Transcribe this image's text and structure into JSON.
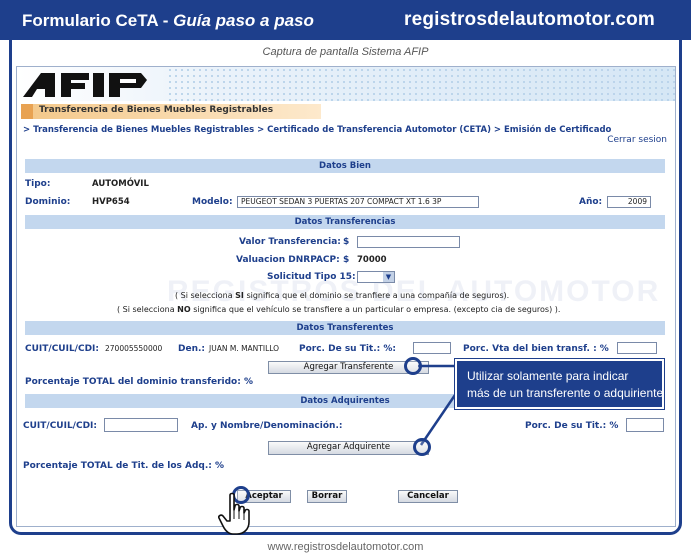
{
  "guide": {
    "title_plain": "Formulario CeTA - ",
    "title_italic": "Guía paso a paso",
    "site": "registrosdelautomotor.com",
    "caption": "Captura de pantalla Sistema AFIP",
    "footer": "www.registrosdelautomotor.com"
  },
  "afip": {
    "logo_text": "AFIP",
    "section": "Transferencia de Bienes Muebles Registrables",
    "breadcrumb": "> Transferencia de Bienes Muebles Registrables > Certificado de Transferencia Automotor (CETA) > Emisión de Certificado",
    "logout": "Cerrar sesion"
  },
  "datos_bien": {
    "header": "Datos Bien",
    "tipo_label": "Tipo:",
    "tipo_value": "AUTOMÓVIL",
    "dominio_label": "Dominio:",
    "dominio_value": "HVP654",
    "modelo_label": "Modelo:",
    "modelo_value": "PEUGEOT SEDAN 3 PUERTAS 207 COMPACT XT 1.6 3P",
    "anio_label": "Año:",
    "anio_value": "2009"
  },
  "datos_transferencias": {
    "header": "Datos Transferencias",
    "valor_label": "Valor Transferencia:",
    "currency": "$",
    "valor_value": "",
    "valuacion_label": "Valuacion DNRPACP:",
    "valuacion_currency": "$",
    "valuacion_value": "70000",
    "solicitud_label": "Solicitud Tipo 15:",
    "solicitud_value": "",
    "note_si_1": "( Si selecciona ",
    "note_si_bold": "SI",
    "note_si_2": " significa que el dominio se tranfiere a una compañía de seguros).",
    "note_no_1": "( Si selecciona ",
    "note_no_bold": "NO",
    "note_no_2": " significa que el vehículo se transfiere a un particular o empresa. (excepto cia de seguros) )."
  },
  "datos_transferentes": {
    "header": "Datos Transferentes",
    "cuit_label": "CUIT/CUIL/CDI:",
    "cuit_value": "270005550000",
    "den_label": "Den.:",
    "den_value": "JUAN M. MANTILLO",
    "porc_tit_label": "Porc. De su Tit.: %:",
    "porc_tit_value": "",
    "porc_vta_label": "Porc. Vta del bien transf. : %",
    "porc_vta_value": "",
    "add_button": "Agregar Transferente",
    "total_label": "Porcentaje TOTAL del dominio transferido: %"
  },
  "datos_adquirentes": {
    "header": "Datos Adquirentes",
    "cuit_label": "CUIT/CUIL/CDI:",
    "cuit_value": "",
    "nombre_label": "Ap. y Nombre/Denominación.:",
    "porc_label": "Porc. De su Tit.: %",
    "porc_value": "",
    "add_button": "Agregar Adquirente",
    "total_label": "Porcentaje TOTAL de Tit. de los Adq.: %"
  },
  "actions": {
    "accept": "Aceptar",
    "clear": "Borrar",
    "cancel": "Cancelar"
  },
  "callout": {
    "line1": "Utilizar solamente para indicar",
    "line2": "más de un transferente o adquiriente"
  },
  "watermark": "REGISTROS DEL AUTOMOTOR",
  "colors": {
    "brand_blue": "#1e3f8c",
    "band_blue": "#c3d7ee",
    "section_orange": "#e8a252"
  }
}
